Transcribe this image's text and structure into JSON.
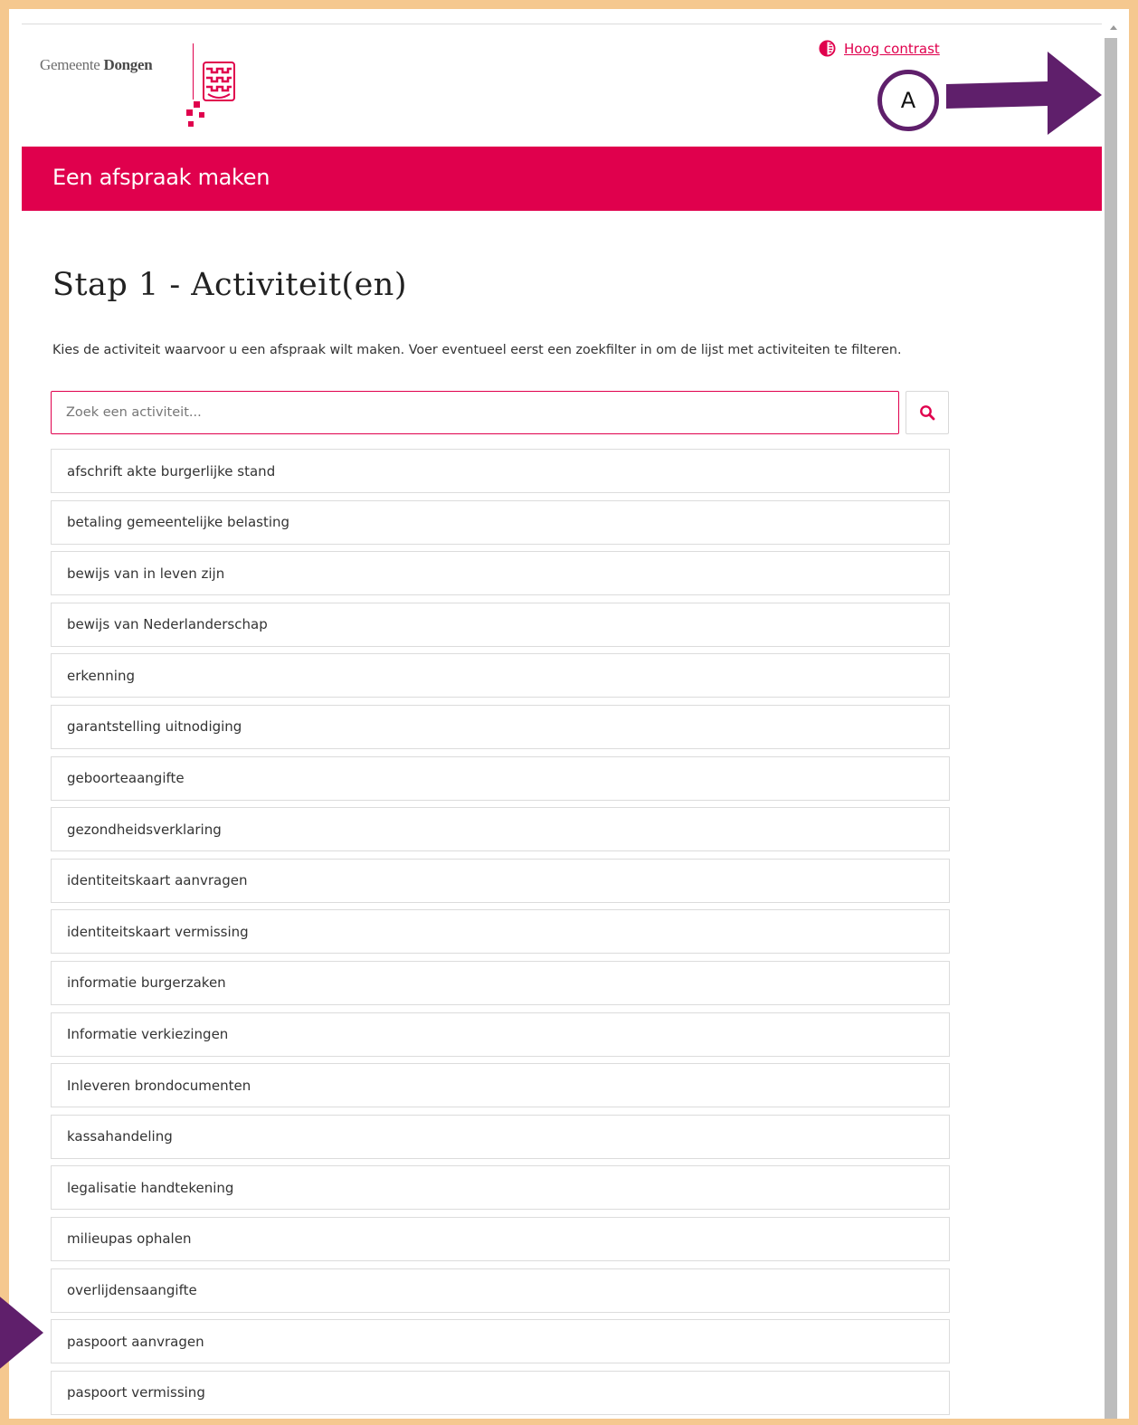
{
  "header": {
    "logo_text_light": "Gemeente",
    "logo_text_bold": "Dongen",
    "contrast_link": "Hoog contrast",
    "annotation_label": "A"
  },
  "banner": {
    "title": "Een afspraak maken"
  },
  "main": {
    "title": "Stap 1 - Activiteit(en)",
    "intro": "Kies de activiteit waarvoor u een afspraak wilt maken. Voer eventueel eerst een zoekfilter in om de lijst met activiteiten te filteren.",
    "search": {
      "placeholder": "Zoek een activiteit..."
    },
    "activities": [
      "afschrift akte burgerlijke stand",
      "betaling gemeentelijke belasting",
      "bewijs van in leven zijn",
      "bewijs van Nederlanderschap",
      "erkenning",
      "garantstelling uitnodiging",
      "geboorteaangifte",
      "gezondheidsverklaring",
      "identiteitskaart aanvragen",
      "identiteitskaart vermissing",
      "informatie burgerzaken",
      "Informatie verkiezingen",
      "Inleveren brondocumenten",
      "kassahandeling",
      "legalisatie handtekening",
      "milieupas ophalen",
      "overlijdensaangifte",
      "paspoort aanvragen",
      "paspoort vermissing"
    ]
  },
  "colors": {
    "brand": "#e0004d",
    "annotation": "#5f1f6b",
    "outer_frame": "#f5c88f"
  },
  "icons": {
    "contrast": "contrast-icon",
    "search": "search-icon",
    "logo": "dongen-crest-icon"
  }
}
